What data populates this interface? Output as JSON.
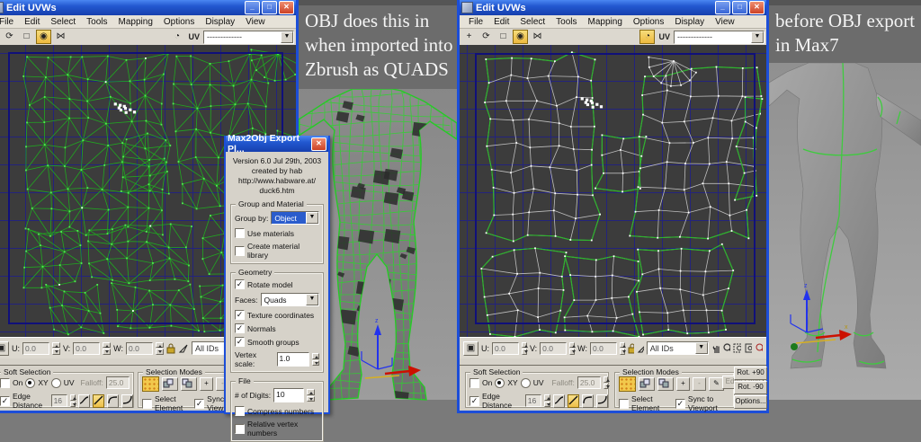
{
  "annotation_mid": {
    "line1": "OBJ does this in",
    "line2": "when imported into",
    "line3": "Zbrush as QUADS"
  },
  "annotation_right": {
    "line1": "before OBJ export",
    "line2": "in  Max7"
  },
  "icons": {
    "move": "+",
    "rotate": "⟳",
    "scale": "□",
    "freeform": "◉",
    "mirror": "⋈",
    "pick": "◔",
    "absolute": "▣",
    "plus": "+",
    "minus": "-",
    "brush": "✎",
    "dropdown": "▼",
    "minimize": "_",
    "maximize": "□",
    "close": "✕",
    "empty_map": "-------------"
  },
  "window_left": {
    "title": "Edit UVWs",
    "menus": [
      "File",
      "Edit",
      "Select",
      "Tools",
      "Mapping",
      "Options",
      "Display",
      "View"
    ],
    "toolbar": {
      "uv_label": "UV"
    },
    "status": {
      "u": "U:",
      "u_val": "0.0",
      "v": "V:",
      "v_val": "0.0",
      "w": "W:",
      "w_val": "0.0",
      "ids": "All IDs"
    },
    "soft": {
      "title": "Soft Selection",
      "on": "On",
      "xy": "XY",
      "uv": "UV",
      "falloff": "Falloff:",
      "falloff_val": "25.0",
      "edge": "Edge Distance",
      "edge_val": "16"
    },
    "modes": {
      "title": "Selection Modes",
      "select_element": "Select Element",
      "sync": "Sync to Viewport"
    }
  },
  "window_right": {
    "title": "Edit UVWs",
    "menus": [
      "File",
      "Edit",
      "Select",
      "Tools",
      "Mapping",
      "Options",
      "Display",
      "View"
    ],
    "toolbar": {
      "uv_label": "UV"
    },
    "status": {
      "u": "U:",
      "u_val": "0.0",
      "v": "V:",
      "v_val": "0.0",
      "w": "W:",
      "w_val": "0.0",
      "ids": "All IDs"
    },
    "soft": {
      "title": "Soft Selection",
      "on": "On",
      "xy": "XY",
      "uv": "UV",
      "falloff": "Falloff:",
      "falloff_val": "25.0",
      "edge": "Edge Distance",
      "edge_val": "16"
    },
    "modes": {
      "title": "Selection Modes",
      "select_element": "Select Element",
      "sync": "Sync to Viewport",
      "edge_loop": "Edge Loop"
    },
    "side_buttons": [
      "Rot. +90",
      "Rot. -90",
      "Options..."
    ]
  },
  "dialog": {
    "title": "Max2Obj Export Pl...",
    "about1": "Version 6.0 Jul 29th, 2003",
    "about2": "created by hab",
    "about3": "http://www.habware.at/",
    "about4": "duck6.htm",
    "group_material": {
      "title": "Group and Material",
      "group_by": "Group by:",
      "group_by_value": "Object",
      "use_materials": "Use materials",
      "create_lib": "Create material library"
    },
    "geometry": {
      "title": "Geometry",
      "rotate": "Rotate model",
      "faces": "Faces:",
      "faces_value": "Quads",
      "texcoords": "Texture coordinates",
      "normals": "Normals",
      "smooth": "Smooth groups",
      "vertex_scale": "Vertex scale:",
      "vertex_scale_value": "1.0"
    },
    "file": {
      "title": "File",
      "digits": "# of Digits:",
      "digits_value": "10",
      "compress": "Compress numbers",
      "relative": "Relative vertex numbers"
    }
  },
  "colors": {
    "wire_green": "#27c827",
    "wire_white": "#c8c8c8",
    "vertex_green": "#55e655",
    "grid": "#23237d",
    "canvas_bg": "#3c3c3c",
    "title_blue": "#2258d0",
    "active_yellow": "#f2c94c",
    "seam_green": "#2db32d"
  }
}
